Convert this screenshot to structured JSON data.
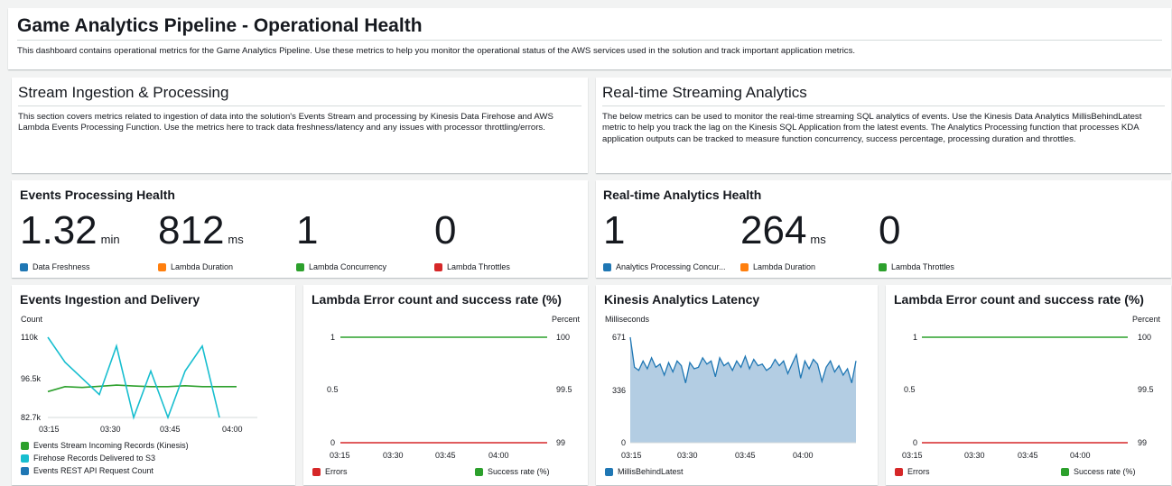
{
  "header": {
    "title": "Game Analytics Pipeline - Operational Health",
    "description": "This dashboard contains operational metrics for the Game Analytics Pipeline. Use these metrics to help you monitor the operational status of the AWS services used in the solution and track important application metrics."
  },
  "stream_section": {
    "title": "Stream Ingestion & Processing",
    "description": "This section covers metrics related to ingestion of data into the solution's Events Stream and processing by Kinesis Data Firehose and AWS Lambda Events Processing Function. Use the metrics here to track data freshness/latency and any issues with processor throttling/errors."
  },
  "realtime_section": {
    "title": "Real-time Streaming Analytics",
    "description": "The below metrics can be used to monitor the real-time streaming SQL analytics of events. Use the Kinesis Data Analytics MillisBehindLatest metric to help you track the lag on the Kinesis SQL Application from the latest events. The Analytics Processing function that processes KDA application outputs can be tracked to measure function concurrency, success percentage, processing duration and throttles."
  },
  "events_health": {
    "title": "Events Processing Health",
    "metrics": [
      {
        "value": "1.32",
        "unit": "min",
        "label": "Data Freshness",
        "color": "#1f77b4"
      },
      {
        "value": "812",
        "unit": "ms",
        "label": "Lambda Duration",
        "color": "#ff7f0e"
      },
      {
        "value": "1",
        "unit": "",
        "label": "Lambda Concurrency",
        "color": "#2ca02c"
      },
      {
        "value": "0",
        "unit": "",
        "label": "Lambda Throttles",
        "color": "#d62728"
      }
    ]
  },
  "analytics_health": {
    "title": "Real-time Analytics Health",
    "metrics": [
      {
        "value": "1",
        "unit": "",
        "label": "Analytics Processing Concur...",
        "color": "#1f77b4"
      },
      {
        "value": "264",
        "unit": "ms",
        "label": "Lambda Duration",
        "color": "#ff7f0e"
      },
      {
        "value": "0",
        "unit": "",
        "label": "Lambda Throttles",
        "color": "#2ca02c"
      }
    ]
  },
  "chart_data": [
    {
      "type": "line",
      "title": "Events Ingestion and Delivery",
      "ylabel": "Count",
      "x": [
        "03:10",
        "03:15",
        "03:20",
        "03:25",
        "03:30",
        "03:35",
        "03:40",
        "03:45",
        "03:50",
        "03:55",
        "04:00",
        "04:05",
        "04:10"
      ],
      "xticks": [
        "03:15",
        "03:30",
        "03:45",
        "04:00"
      ],
      "yticks": [
        "110k",
        "96.5k",
        "82.7k"
      ],
      "ylim": [
        82700,
        110000
      ],
      "series": [
        {
          "name": "Events Stream Incoming Records (Kinesis)",
          "color": "#2ca02c",
          "values": [
            91500,
            93200,
            92900,
            93300,
            93700,
            93400,
            93200,
            93200,
            93500,
            93200,
            93200,
            93200,
            null
          ]
        },
        {
          "name": "Firehose Records Delivered to S3",
          "color": "#17becf",
          "values": [
            110000,
            101500,
            96000,
            90500,
            107000,
            82700,
            98500,
            82700,
            98500,
            107000,
            82700,
            null,
            null
          ]
        },
        {
          "name": "Events REST API Request Count",
          "color": "#1f77b4",
          "values": []
        }
      ]
    },
    {
      "type": "line",
      "title": "Lambda Error count and success rate (%)",
      "ylabel_right": "Percent",
      "xticks": [
        "03:15",
        "03:30",
        "03:45",
        "04:00"
      ],
      "yticks_left": [
        "1",
        "0.5",
        "0"
      ],
      "yticks_right": [
        "100",
        "99.5",
        "99"
      ],
      "series": [
        {
          "name": "Errors",
          "color": "#d62728",
          "values": [
            0,
            0
          ]
        },
        {
          "name": "Success rate (%)",
          "color": "#2ca02c",
          "values": [
            100,
            100
          ]
        }
      ]
    },
    {
      "type": "area",
      "title": "Kinesis Analytics Latency",
      "ylabel": "Milliseconds",
      "xticks": [
        "03:15",
        "03:30",
        "03:45",
        "04:00"
      ],
      "yticks": [
        "671",
        "336",
        "0"
      ],
      "ylim": [
        0,
        671
      ],
      "series": [
        {
          "name": "MillisBehindLatest",
          "color": "#1f77b4",
          "values": [
            671,
            480,
            460,
            520,
            470,
            540,
            480,
            500,
            430,
            510,
            450,
            520,
            490,
            380,
            510,
            470,
            480,
            540,
            500,
            520,
            420,
            540,
            490,
            510,
            460,
            520,
            480,
            550,
            470,
            530,
            490,
            500,
            460,
            480,
            530,
            490,
            520,
            440,
            500,
            560,
            410,
            520,
            470,
            530,
            500,
            390,
            480,
            520,
            450,
            490,
            430,
            470,
            380,
            520
          ]
        }
      ]
    },
    {
      "type": "line",
      "title": "Lambda Error count and success rate (%)",
      "ylabel_right": "Percent",
      "xticks": [
        "03:15",
        "03:30",
        "03:45",
        "04:00"
      ],
      "yticks_left": [
        "1",
        "0.5",
        "0"
      ],
      "yticks_right": [
        "100",
        "99.5",
        "99"
      ],
      "series": [
        {
          "name": "Errors",
          "color": "#d62728",
          "values": [
            0,
            0
          ]
        },
        {
          "name": "Success rate (%)",
          "color": "#2ca02c",
          "values": [
            100,
            100
          ]
        }
      ]
    }
  ]
}
